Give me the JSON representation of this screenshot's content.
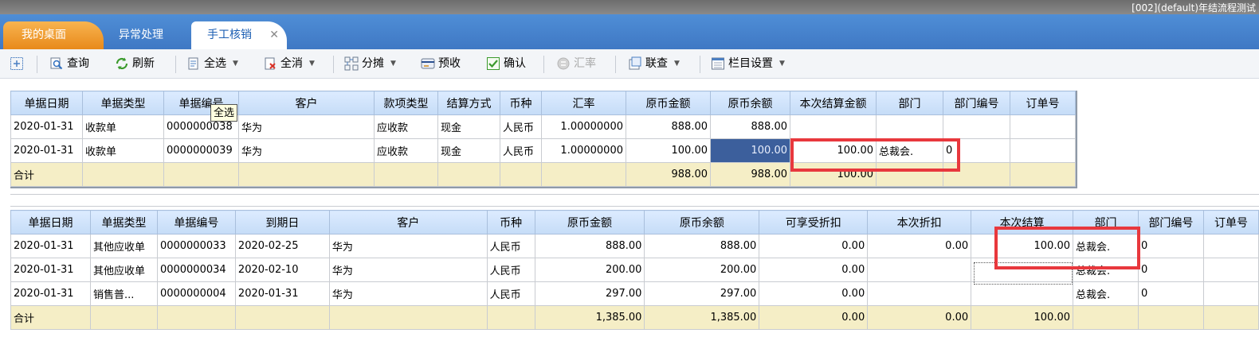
{
  "window": {
    "title": "[002](default)年结流程测试"
  },
  "tabs": [
    {
      "label": "我的桌面"
    },
    {
      "label": "异常处理"
    },
    {
      "label": "手工核销"
    }
  ],
  "toolbar": {
    "query": "查询",
    "refresh": "刷新",
    "select_all": "全选",
    "deselect_all": "全消",
    "allocate": "分摊",
    "prepay": "预收",
    "confirm": "确认",
    "exchange_rate": "汇率",
    "linked_query": "联查",
    "column_settings": "栏目设置"
  },
  "tooltip": {
    "text": "全选"
  },
  "receipts": {
    "columns": [
      "单据日期",
      "单据类型",
      "单据编号",
      "客户",
      "款项类型",
      "结算方式",
      "币种",
      "汇率",
      "原币金额",
      "原币余额",
      "本次结算金额",
      "部门",
      "部门编号",
      "订单号"
    ],
    "rows": [
      [
        "2020-01-31",
        "收款单",
        "0000000038",
        "华为",
        "应收款",
        "现金",
        "人民币",
        "1.00000000",
        "888.00",
        "888.00",
        "",
        "",
        "",
        ""
      ],
      [
        "2020-01-31",
        "收款单",
        "0000000039",
        "华为",
        "应收款",
        "现金",
        "人民币",
        "1.00000000",
        "100.00",
        "100.00",
        "100.00",
        "总裁会.",
        "0",
        ""
      ]
    ],
    "total": [
      "合计",
      "",
      "",
      "",
      "",
      "",
      "",
      "",
      "988.00",
      "988.00",
      "100.00",
      "",
      "",
      ""
    ]
  },
  "bills": {
    "columns": [
      "单据日期",
      "单据类型",
      "单据编号",
      "到期日",
      "客户",
      "币种",
      "原币金额",
      "原币余额",
      "可享受折扣",
      "本次折扣",
      "本次结算",
      "部门",
      "部门编号",
      "订单号"
    ],
    "rows": [
      [
        "2020-01-31",
        "其他应收单",
        "0000000033",
        "2020-02-25",
        "华为",
        "人民币",
        "888.00",
        "888.00",
        "0.00",
        "0.00",
        "100.00",
        "总裁会.",
        "0",
        ""
      ],
      [
        "2020-01-31",
        "其他应收单",
        "0000000034",
        "2020-02-10",
        "华为",
        "人民币",
        "200.00",
        "200.00",
        "0.00",
        "",
        "",
        "总裁会.",
        "0",
        ""
      ],
      [
        "2020-01-31",
        "销售普...",
        "0000000004",
        "2020-01-31",
        "华为",
        "人民币",
        "297.00",
        "297.00",
        "0.00",
        "",
        "",
        "总裁会.",
        "0",
        ""
      ]
    ],
    "total": [
      "合计",
      "",
      "",
      "",
      "",
      "",
      "1,385.00",
      "1,385.00",
      "0.00",
      "0.00",
      "100.00",
      "",
      "",
      ""
    ]
  },
  "colors": {
    "accent": "#3f78c4",
    "active_tab": "#e8891a",
    "highlight": "#e8383d",
    "total_row": "#f5eec6"
  }
}
